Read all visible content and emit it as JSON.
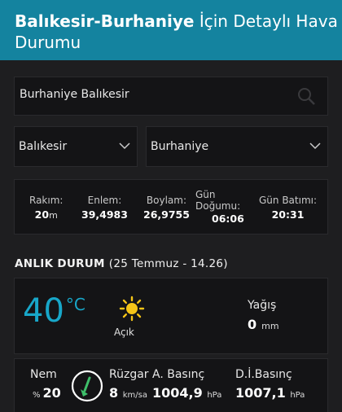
{
  "header": {
    "title_bold": "Balıkesir-Burhaniye",
    "title_rest": " İçin Detaylı Hava",
    "title_line2": "Durumu"
  },
  "search": {
    "value": "Burhaniye Balıkesir",
    "icon": "search-icon"
  },
  "selects": {
    "province": "Balıkesir",
    "district": "Burhaniye"
  },
  "location_info": {
    "altitude": {
      "label": "Rakım:",
      "value": "20",
      "unit": "m"
    },
    "latitude": {
      "label": "Enlem:",
      "value": "39,4983"
    },
    "longitude": {
      "label": "Boylam:",
      "value": "26,9755"
    },
    "sunrise": {
      "label_1": "Gün",
      "label_2": "Doğumu:",
      "value": "06:06"
    },
    "sunset": {
      "label": "Gün Batımı:",
      "value": "20:31"
    }
  },
  "current": {
    "title": "ANLIK DURUM",
    "date": "(25 Temmuz - 14.26)",
    "temperature": "40",
    "temp_unit": "°C",
    "condition": "Açık",
    "condition_icon": "sun-icon",
    "precip_label": "Yağış",
    "precip_value": "0",
    "precip_unit": "mm"
  },
  "details": {
    "humidity": {
      "label": "Nem",
      "prefix": "%",
      "value": "20"
    },
    "wind": {
      "label": "Rüzgar",
      "value": "8",
      "unit": "km/sa",
      "icon": "wind-direction-icon"
    },
    "pressure": {
      "label": "A. Basınç",
      "value": "1004,9",
      "unit": "hPa"
    },
    "sea_pressure": {
      "label": "D.İ.Basınç",
      "value": "1007,1",
      "unit": "hPa"
    }
  },
  "colors": {
    "header_bg": "#14839f",
    "temp": "#18a7c9",
    "sun": "#f5c518"
  }
}
